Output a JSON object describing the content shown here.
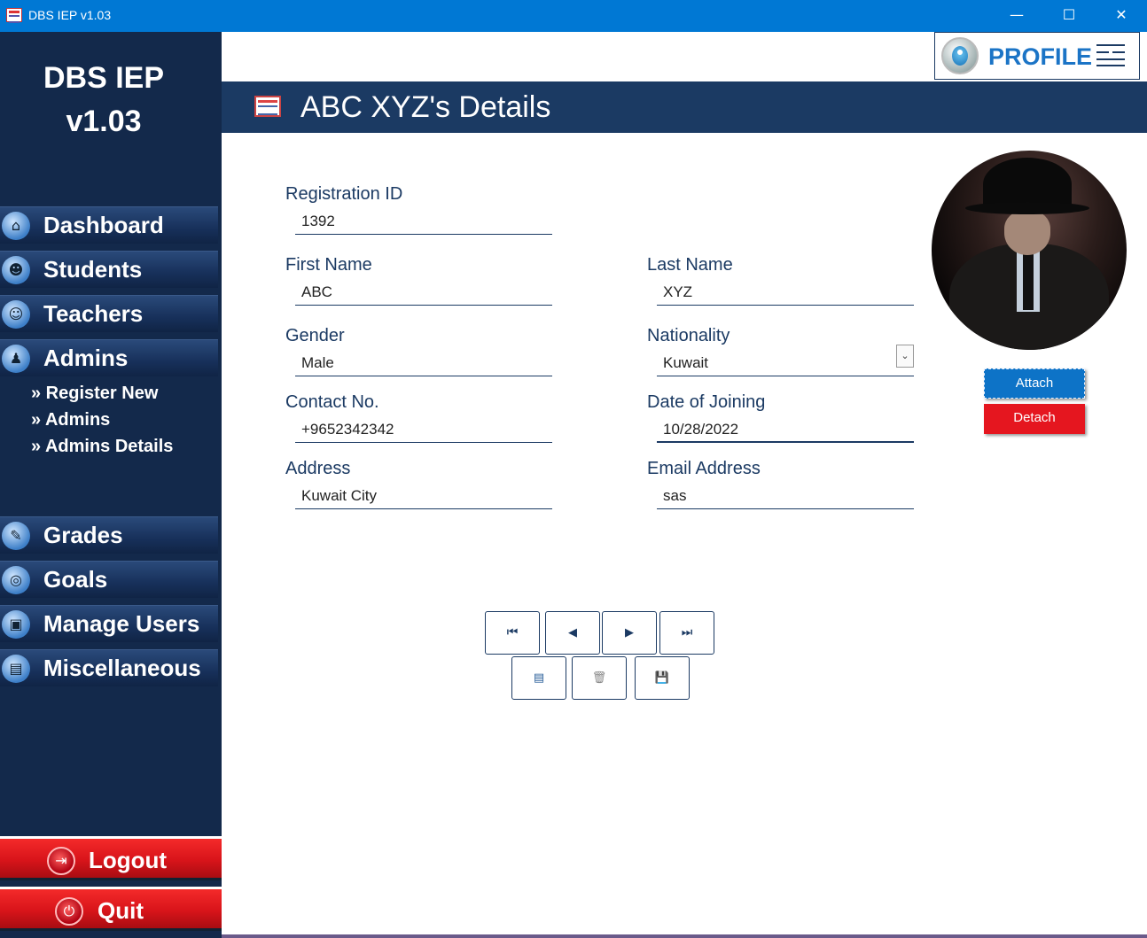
{
  "window": {
    "title": "DBS IEP v1.03",
    "minimize_glyph": "—",
    "maximize_glyph": "☐",
    "close_glyph": "✕"
  },
  "sidebar": {
    "brand_line1": "DBS IEP",
    "brand_line2": "v1.03",
    "items": [
      {
        "label": "Dashboard",
        "icon": "home-icon",
        "glyph": "⌂"
      },
      {
        "label": "Students",
        "icon": "students-group-icon",
        "glyph": "☻"
      },
      {
        "label": "Teachers",
        "icon": "teacher-icon",
        "glyph": "☺"
      },
      {
        "label": "Admins",
        "icon": "admin-icon",
        "glyph": "♟"
      }
    ],
    "sub_items": [
      {
        "label": "» Register New"
      },
      {
        "label": "» Admins"
      },
      {
        "label": "» Admins Details"
      }
    ],
    "lower_items": [
      {
        "label": "Grades",
        "icon": "grades-chart-icon",
        "glyph": "✎"
      },
      {
        "label": "Goals",
        "icon": "target-icon",
        "glyph": "◎"
      },
      {
        "label": "Manage Users",
        "icon": "manage-users-icon",
        "glyph": "▣"
      },
      {
        "label": "Miscellaneous",
        "icon": "miscellaneous-icon",
        "glyph": "▤"
      }
    ],
    "logout_label": "Logout",
    "logout_glyph": "⇥",
    "quit_label": "Quit",
    "quit_glyph": "⏻"
  },
  "profile": {
    "label": "PROFILE"
  },
  "header": {
    "title": "ABC XYZ's Details"
  },
  "form": {
    "registration_id": {
      "label": "Registration ID",
      "value": "1392"
    },
    "first_name": {
      "label": "First Name",
      "value": "ABC"
    },
    "last_name": {
      "label": "Last Name",
      "value": "XYZ"
    },
    "gender": {
      "label": "Gender",
      "value": "Male"
    },
    "nationality": {
      "label": "Nationality",
      "value": "Kuwait",
      "arrow": "⌄"
    },
    "contact": {
      "label": "Contact No.",
      "value": "+9652342342"
    },
    "date_of_joining": {
      "label": "Date of Joining",
      "value": "10/28/2022"
    },
    "address": {
      "label": "Address",
      "value": "Kuwait City"
    },
    "email": {
      "label": "Email Address",
      "value": "sas"
    }
  },
  "photo": {
    "attach_label": "Attach",
    "detach_label": "Detach"
  },
  "record_nav": {
    "first_glyph": "⏮",
    "prev_glyph": "◀",
    "next_glyph": "▶",
    "last_glyph": "⏭",
    "new_glyph": "▤",
    "delete_glyph": "🗑",
    "save_glyph": "💾"
  },
  "colors": {
    "titlebar": "#0078d4",
    "sidebar": "#13294b",
    "header": "#1b3a63",
    "accent_blue": "#1b74c6",
    "attach_blue": "#0d73c7",
    "danger_red": "#e5161f"
  }
}
